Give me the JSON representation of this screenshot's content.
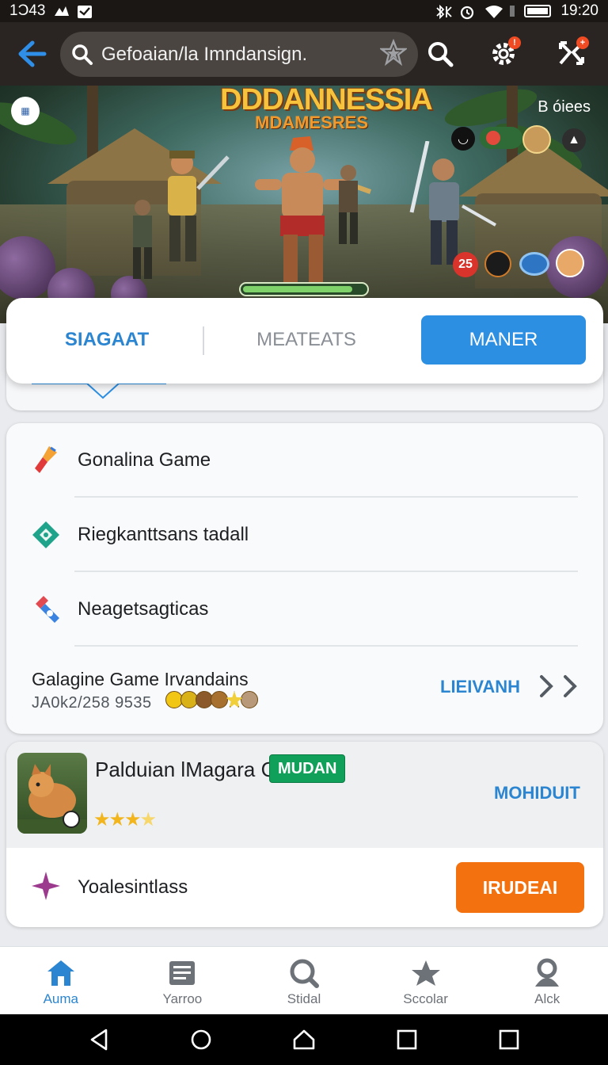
{
  "status_bar": {
    "time_left": "1Ͻ43",
    "time_right": "19:20"
  },
  "app_bar": {
    "search_text": "Gefoaian/la Imndansign."
  },
  "hero": {
    "title": "DDDANNESSIA",
    "subtitle": "MDAMESRES",
    "label": "B óiees",
    "chip_count": "25",
    "progress": 0.9
  },
  "tabs": [
    {
      "label": "SIAGAAT"
    },
    {
      "label": "MEATEATS"
    },
    {
      "label": "MANER"
    }
  ],
  "list": {
    "items": [
      {
        "label": "Gonalina Game",
        "icon": "brush-icon"
      },
      {
        "label": "Riegkanttsans tadall",
        "icon": "diamond-icon"
      },
      {
        "label": "Neagetsagticas",
        "icon": "tools-icon"
      }
    ],
    "game": {
      "title": "Galagine Game Irvandains",
      "meta": "JA0k2/258 9535",
      "link": "LIEIVANH"
    }
  },
  "featured": {
    "title": "Palduian lMagara Ganok",
    "badge": "MUDAN",
    "rating": 4,
    "link": "MOHIDUIT",
    "row_label": "Yoalesintlass",
    "button": "IRUDEAI"
  },
  "bottom_nav": [
    {
      "label": "Auma",
      "icon": "home-icon"
    },
    {
      "label": "Yarroo",
      "icon": "news-icon"
    },
    {
      "label": "Stidal",
      "icon": "search-icon"
    },
    {
      "label": "Sccolar",
      "icon": "star-icon"
    },
    {
      "label": "Alck",
      "icon": "profile-icon"
    }
  ],
  "colors": {
    "accent": "#2b85d0",
    "active_tab": "#2d8fe2",
    "badge_green": "#11a05a",
    "cta_orange": "#f3720f"
  }
}
